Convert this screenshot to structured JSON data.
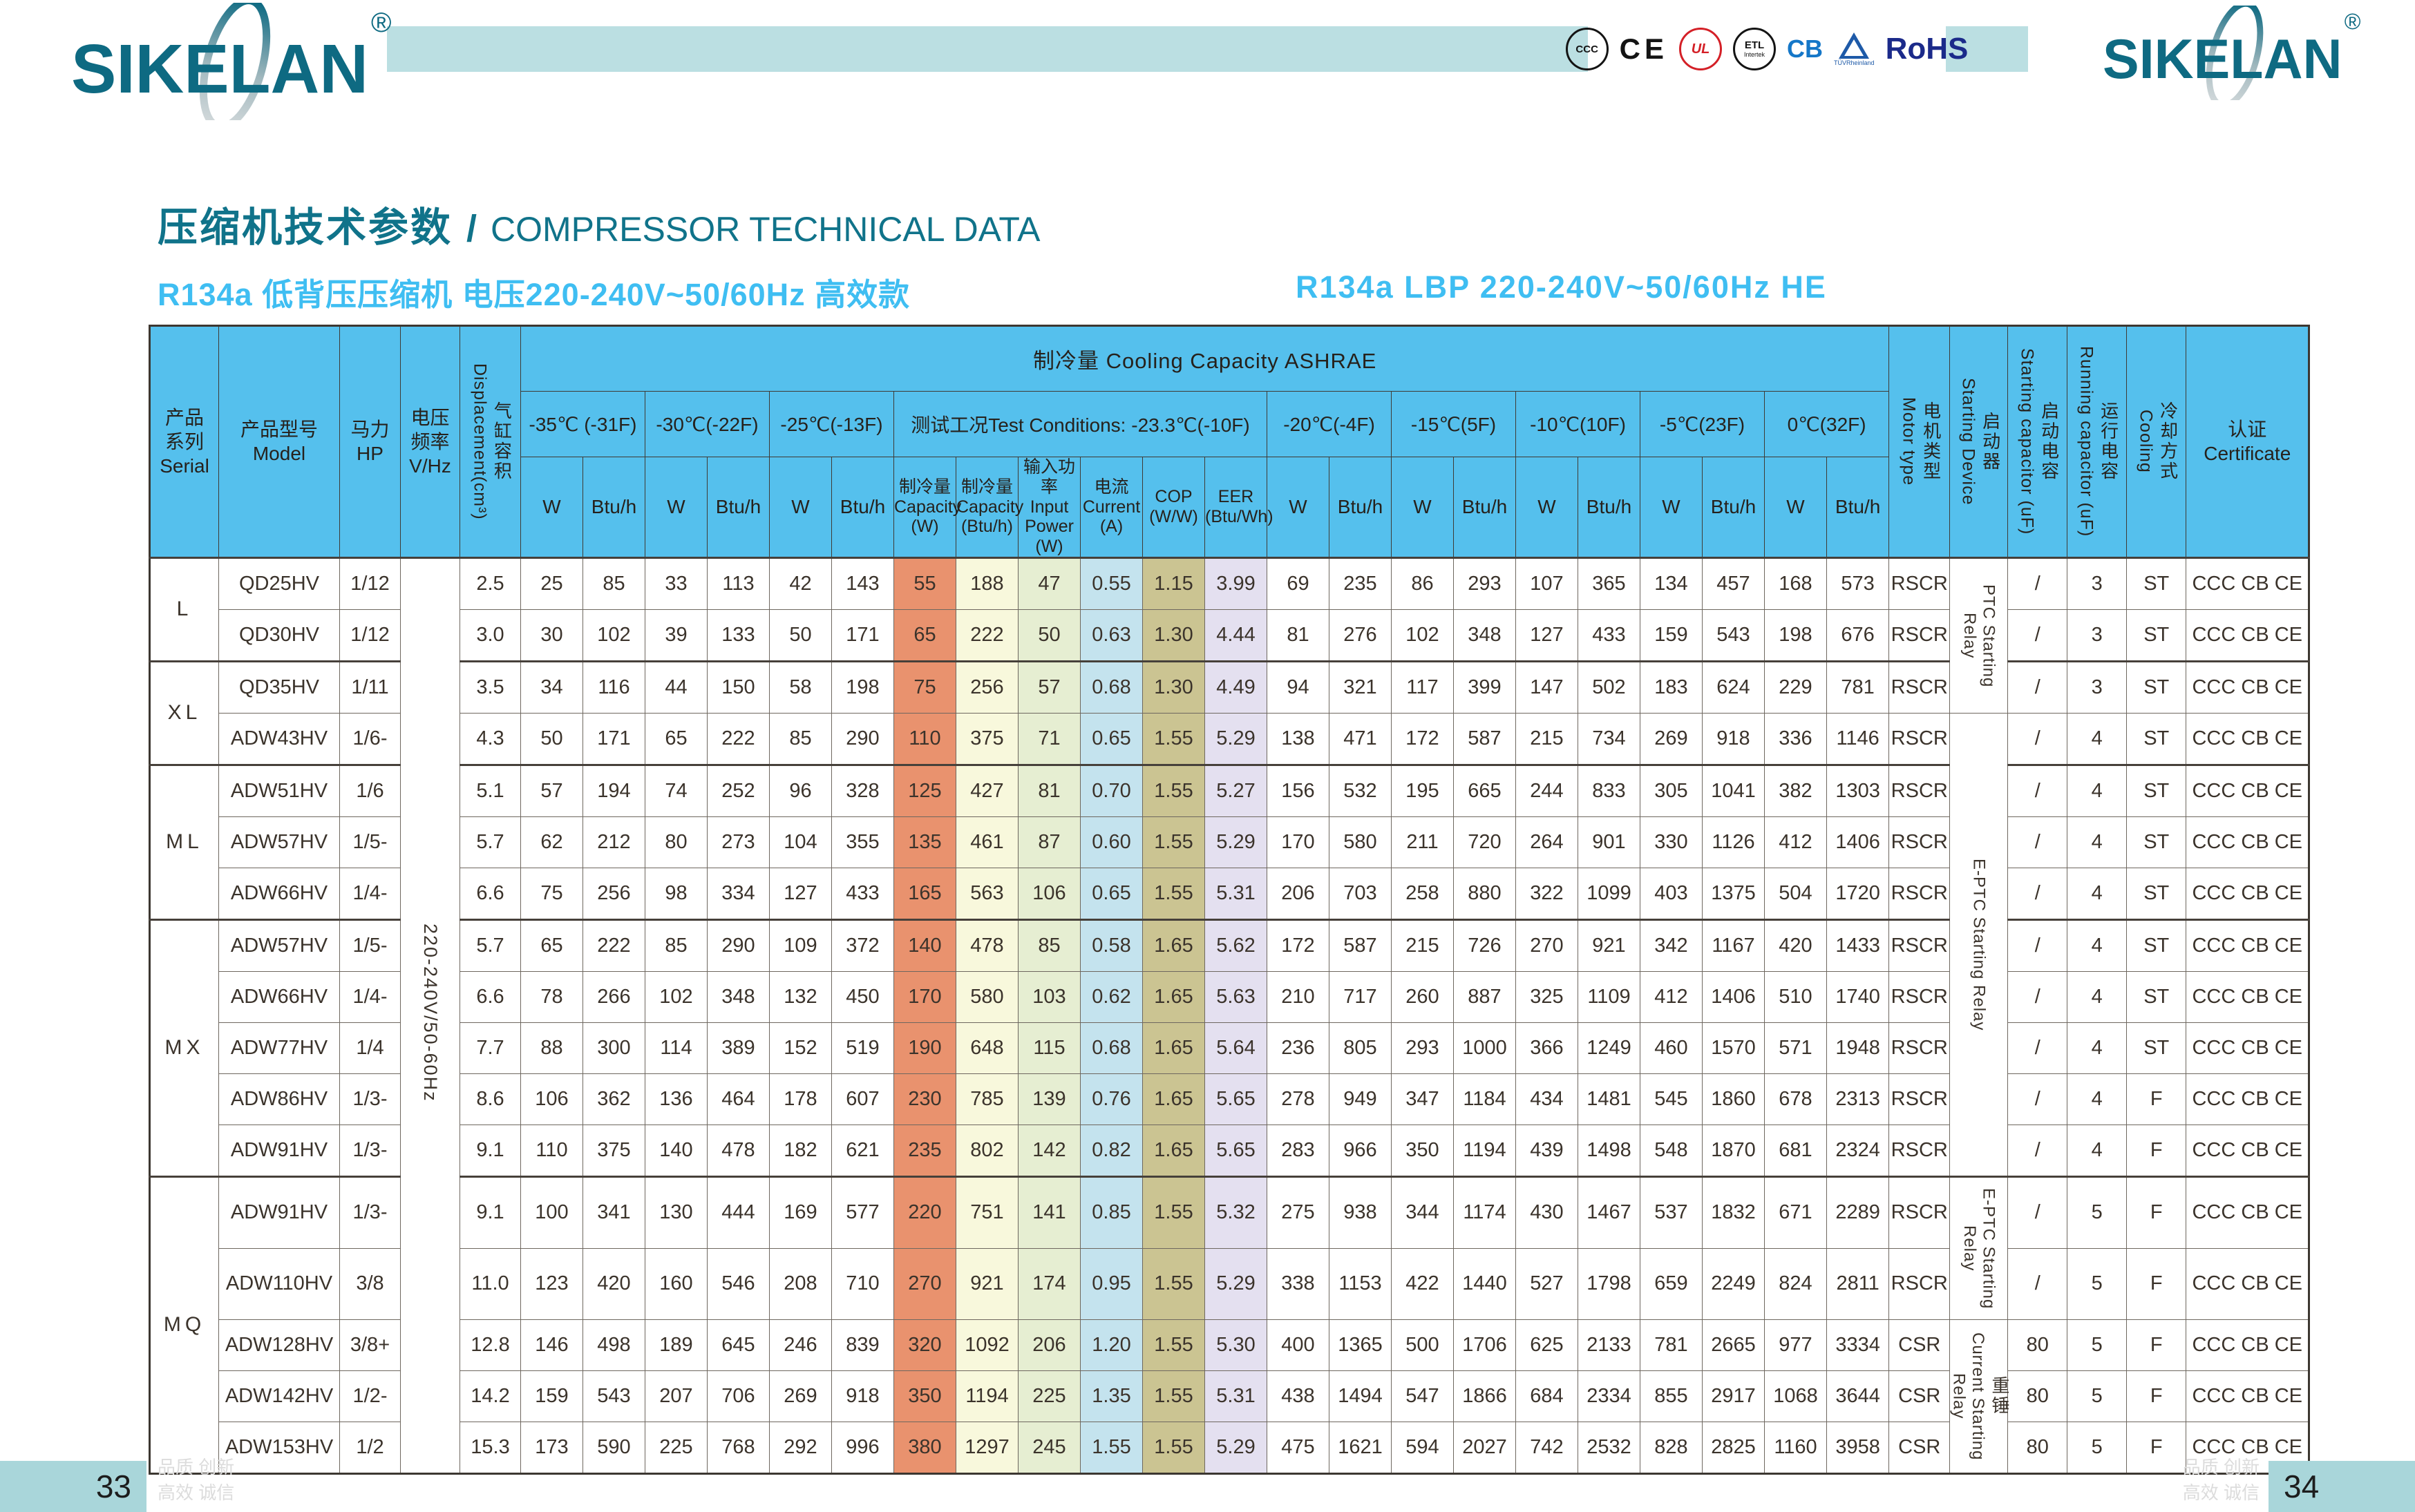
{
  "page": {
    "brand": "SIKELAN",
    "reg_mark": "®",
    "title_zh": "压缩机技术参数",
    "title_slash": "/",
    "title_en": "COMPRESSOR TECHNICAL DATA",
    "subtitle_left": "R134a   低背压压缩机   电压220-240V~50/60Hz   高效款",
    "subtitle_right": "R134a   LBP   220-240V~50/60Hz   HE",
    "footer": {
      "left_page": "33",
      "right_page": "34",
      "slogan_line1": "品质 创新",
      "slogan_line2": "高效 诚信"
    }
  },
  "colors": {
    "header_bg": "#55C0ED",
    "banner": "#BBDFE2",
    "page_block": "#A9D6DA",
    "brand_teal": "#0E6A82",
    "title_teal": "#10738A",
    "subtitle_blue": "#3FBEF2",
    "capacity_w_bg": "#E9926E",
    "capacity_btu_bg": "#F8F8DC",
    "input_power_bg": "#E6EED2",
    "current_bg": "#C4E3EE",
    "cop_bg": "#CBC492",
    "eer_bg": "#E4E0F0",
    "cb_blue": "#1577C8",
    "rohs_navy": "#1B2A8A",
    "ul_red": "#D42027",
    "tuv_blue": "#1E5AA8"
  },
  "certifications": [
    {
      "id": "ccc",
      "label": "CCC"
    },
    {
      "id": "ce",
      "label": "CE"
    },
    {
      "id": "ul",
      "label": "UL"
    },
    {
      "id": "etl",
      "label": "ETL",
      "sub": "Intertek"
    },
    {
      "id": "cb",
      "label": "CB"
    },
    {
      "id": "tuv",
      "label": "TÜVRheinland"
    },
    {
      "id": "rohs",
      "label": "RoHS"
    }
  ],
  "table": {
    "header": {
      "serial": [
        "产品",
        "系列",
        "Serial"
      ],
      "model": [
        "产品型号",
        "Model"
      ],
      "hp": "马力HP",
      "vhz": [
        "电压",
        "频率",
        "V/Hz"
      ],
      "disp": {
        "zh": "气缸容积",
        "en": "Displacement(cm³)"
      },
      "cooling_title": "制冷量    Cooling  Capacity  ASHRAE",
      "temps": [
        "-35℃ (-31F)",
        "-30℃(-22F)",
        "-25℃(-13F)",
        "测试工况Test Conditions: -23.3℃(-10F)",
        "-20℃(-4F)",
        "-15℃(5F)",
        "-10℃(10F)",
        "-5℃(23F)",
        "0℃(32F)"
      ],
      "unit_w": "W",
      "unit_btu": "Btu/h",
      "test_cols": [
        [
          "制冷量",
          "Capacity",
          "(W)"
        ],
        [
          "制冷量",
          "Capacity",
          "(Btu/h)"
        ],
        [
          "输入功率",
          "Input",
          "Power",
          "(W)"
        ],
        [
          "电流",
          "Current",
          "(A)"
        ],
        [
          "COP",
          "(W/W)"
        ],
        [
          "EER",
          "(Btu/Wh)"
        ]
      ],
      "motor": {
        "zh": "电机类型",
        "en": "Motor type"
      },
      "sdev": {
        "zh": "启动器",
        "en": "Starting Device"
      },
      "scap": {
        "zh": "启动电容",
        "en": "Starting capacitor (uF)"
      },
      "rcap": {
        "zh": "运行电容",
        "en": "Running capacitor (uF)"
      },
      "cool": {
        "zh": "冷却方式",
        "en": "Cooling"
      },
      "cert": [
        "认证",
        "Certificate"
      ]
    },
    "vhz": "220-240V/50-60Hz",
    "vhz_span": 17,
    "starting_devices": {
      "ptc": {
        "en": "PTC Starting Relay",
        "zh": "",
        "span": 3
      },
      "eptc": {
        "en": "E-PTC Starting Relay",
        "zh": "",
        "span": 9
      },
      "eptc2": {
        "en": "E-PTC Starting Relay",
        "zh": "",
        "span": 2
      },
      "csr": {
        "en": "Current Starting Relay",
        "zh": "重锤",
        "span": 3
      }
    },
    "rows": [
      {
        "serial": "L",
        "serial_span": 2,
        "model": "QD25HV",
        "hp": "1/12",
        "disp": "2.5",
        "c1": [
          "25",
          "85",
          "33",
          "113",
          "42",
          "143"
        ],
        "test": [
          "55",
          "188",
          "47",
          "0.55",
          "1.15",
          "3.99"
        ],
        "c2": [
          "69",
          "235",
          "86",
          "293",
          "107",
          "365",
          "134",
          "457",
          "168",
          "573"
        ],
        "motor": "RSCR",
        "sdev": "ptc",
        "scap": "/",
        "rcap": "3",
        "cool": "ST",
        "cert": "CCC CB CE"
      },
      {
        "model": "QD30HV",
        "hp": "1/12",
        "disp": "3.0",
        "c1": [
          "30",
          "102",
          "39",
          "133",
          "50",
          "171"
        ],
        "test": [
          "65",
          "222",
          "50",
          "0.63",
          "1.30",
          "4.44"
        ],
        "c2": [
          "81",
          "276",
          "102",
          "348",
          "127",
          "433",
          "159",
          "543",
          "198",
          "676"
        ],
        "motor": "RSCR",
        "scap": "/",
        "rcap": "3",
        "cool": "ST",
        "cert": "CCC CB CE"
      },
      {
        "serial": "XL",
        "serial_span": 2,
        "model": "QD35HV",
        "hp": "1/11",
        "disp": "3.5",
        "c1": [
          "34",
          "116",
          "44",
          "150",
          "58",
          "198"
        ],
        "test": [
          "75",
          "256",
          "57",
          "0.68",
          "1.30",
          "4.49"
        ],
        "c2": [
          "94",
          "321",
          "117",
          "399",
          "147",
          "502",
          "183",
          "624",
          "229",
          "781"
        ],
        "motor": "RSCR",
        "scap": "/",
        "rcap": "3",
        "cool": "ST",
        "cert": "CCC CB CE"
      },
      {
        "model": "ADW43HV",
        "hp": "1/6-",
        "disp": "4.3",
        "c1": [
          "50",
          "171",
          "65",
          "222",
          "85",
          "290"
        ],
        "test": [
          "110",
          "375",
          "71",
          "0.65",
          "1.55",
          "5.29"
        ],
        "c2": [
          "138",
          "471",
          "172",
          "587",
          "215",
          "734",
          "269",
          "918",
          "336",
          "1146"
        ],
        "motor": "RSCR",
        "sdev": "eptc",
        "scap": "/",
        "rcap": "4",
        "cool": "ST",
        "cert": "CCC CB CE"
      },
      {
        "serial": "ML",
        "serial_span": 3,
        "model": "ADW51HV",
        "hp": "1/6",
        "disp": "5.1",
        "c1": [
          "57",
          "194",
          "74",
          "252",
          "96",
          "328"
        ],
        "test": [
          "125",
          "427",
          "81",
          "0.70",
          "1.55",
          "5.27"
        ],
        "c2": [
          "156",
          "532",
          "195",
          "665",
          "244",
          "833",
          "305",
          "1041",
          "382",
          "1303"
        ],
        "motor": "RSCR",
        "scap": "/",
        "rcap": "4",
        "cool": "ST",
        "cert": "CCC CB CE"
      },
      {
        "model": "ADW57HV",
        "hp": "1/5-",
        "disp": "5.7",
        "c1": [
          "62",
          "212",
          "80",
          "273",
          "104",
          "355"
        ],
        "test": [
          "135",
          "461",
          "87",
          "0.60",
          "1.55",
          "5.29"
        ],
        "c2": [
          "170",
          "580",
          "211",
          "720",
          "264",
          "901",
          "330",
          "1126",
          "412",
          "1406"
        ],
        "motor": "RSCR",
        "scap": "/",
        "rcap": "4",
        "cool": "ST",
        "cert": "CCC CB CE"
      },
      {
        "model": "ADW66HV",
        "hp": "1/4-",
        "disp": "6.6",
        "c1": [
          "75",
          "256",
          "98",
          "334",
          "127",
          "433"
        ],
        "test": [
          "165",
          "563",
          "106",
          "0.65",
          "1.55",
          "5.31"
        ],
        "c2": [
          "206",
          "703",
          "258",
          "880",
          "322",
          "1099",
          "403",
          "1375",
          "504",
          "1720"
        ],
        "motor": "RSCR",
        "scap": "/",
        "rcap": "4",
        "cool": "ST",
        "cert": "CCC CB CE"
      },
      {
        "serial": "MX",
        "serial_span": 5,
        "model": "ADW57HV",
        "hp": "1/5-",
        "disp": "5.7",
        "c1": [
          "65",
          "222",
          "85",
          "290",
          "109",
          "372"
        ],
        "test": [
          "140",
          "478",
          "85",
          "0.58",
          "1.65",
          "5.62"
        ],
        "c2": [
          "172",
          "587",
          "215",
          "726",
          "270",
          "921",
          "342",
          "1167",
          "420",
          "1433"
        ],
        "motor": "RSCR",
        "scap": "/",
        "rcap": "4",
        "cool": "ST",
        "cert": "CCC CB CE"
      },
      {
        "model": "ADW66HV",
        "hp": "1/4-",
        "disp": "6.6",
        "c1": [
          "78",
          "266",
          "102",
          "348",
          "132",
          "450"
        ],
        "test": [
          "170",
          "580",
          "103",
          "0.62",
          "1.65",
          "5.63"
        ],
        "c2": [
          "210",
          "717",
          "260",
          "887",
          "325",
          "1109",
          "412",
          "1406",
          "510",
          "1740"
        ],
        "motor": "RSCR",
        "scap": "/",
        "rcap": "4",
        "cool": "ST",
        "cert": "CCC CB CE"
      },
      {
        "model": "ADW77HV",
        "hp": "1/4",
        "disp": "7.7",
        "c1": [
          "88",
          "300",
          "114",
          "389",
          "152",
          "519"
        ],
        "test": [
          "190",
          "648",
          "115",
          "0.68",
          "1.65",
          "5.64"
        ],
        "c2": [
          "236",
          "805",
          "293",
          "1000",
          "366",
          "1249",
          "460",
          "1570",
          "571",
          "1948"
        ],
        "motor": "RSCR",
        "scap": "/",
        "rcap": "4",
        "cool": "ST",
        "cert": "CCC CB CE"
      },
      {
        "model": "ADW86HV",
        "hp": "1/3-",
        "disp": "8.6",
        "c1": [
          "106",
          "362",
          "136",
          "464",
          "178",
          "607"
        ],
        "test": [
          "230",
          "785",
          "139",
          "0.76",
          "1.65",
          "5.65"
        ],
        "c2": [
          "278",
          "949",
          "347",
          "1184",
          "434",
          "1481",
          "545",
          "1860",
          "678",
          "2313"
        ],
        "motor": "RSCR",
        "scap": "/",
        "rcap": "4",
        "cool": "F",
        "cert": "CCC CB CE"
      },
      {
        "model": "ADW91HV",
        "hp": "1/3-",
        "disp": "9.1",
        "c1": [
          "110",
          "375",
          "140",
          "478",
          "182",
          "621"
        ],
        "test": [
          "235",
          "802",
          "142",
          "0.82",
          "1.65",
          "5.65"
        ],
        "c2": [
          "283",
          "966",
          "350",
          "1194",
          "439",
          "1498",
          "548",
          "1870",
          "681",
          "2324"
        ],
        "motor": "RSCR",
        "scap": "/",
        "rcap": "4",
        "cool": "F",
        "cert": "CCC CB CE"
      },
      {
        "serial": "MQ",
        "serial_span": 5,
        "model": "ADW91HV",
        "hp": "1/3-",
        "disp": "9.1",
        "c1": [
          "100",
          "341",
          "130",
          "444",
          "169",
          "577"
        ],
        "test": [
          "220",
          "751",
          "141",
          "0.85",
          "1.55",
          "5.32"
        ],
        "c2": [
          "275",
          "938",
          "344",
          "1174",
          "430",
          "1467",
          "537",
          "1832",
          "671",
          "2289"
        ],
        "motor": "RSCR",
        "sdev": "eptc2",
        "scap": "/",
        "rcap": "5",
        "cool": "F",
        "cert": "CCC CB CE"
      },
      {
        "model": "ADW110HV",
        "hp": "3/8",
        "disp": "11.0",
        "c1": [
          "123",
          "420",
          "160",
          "546",
          "208",
          "710"
        ],
        "test": [
          "270",
          "921",
          "174",
          "0.95",
          "1.55",
          "5.29"
        ],
        "c2": [
          "338",
          "1153",
          "422",
          "1440",
          "527",
          "1798",
          "659",
          "2249",
          "824",
          "2811"
        ],
        "motor": "RSCR",
        "scap": "/",
        "rcap": "5",
        "cool": "F",
        "cert": "CCC CB CE"
      },
      {
        "model": "ADW128HV",
        "hp": "3/8+",
        "disp": "12.8",
        "c1": [
          "146",
          "498",
          "189",
          "645",
          "246",
          "839"
        ],
        "test": [
          "320",
          "1092",
          "206",
          "1.20",
          "1.55",
          "5.30"
        ],
        "c2": [
          "400",
          "1365",
          "500",
          "1706",
          "625",
          "2133",
          "781",
          "2665",
          "977",
          "3334"
        ],
        "motor": "CSR",
        "sdev": "csr",
        "scap": "80",
        "rcap": "5",
        "cool": "F",
        "cert": "CCC CB CE"
      },
      {
        "model": "ADW142HV",
        "hp": "1/2-",
        "disp": "14.2",
        "c1": [
          "159",
          "543",
          "207",
          "706",
          "269",
          "918"
        ],
        "test": [
          "350",
          "1194",
          "225",
          "1.35",
          "1.55",
          "5.31"
        ],
        "c2": [
          "438",
          "1494",
          "547",
          "1866",
          "684",
          "2334",
          "855",
          "2917",
          "1068",
          "3644"
        ],
        "motor": "CSR",
        "scap": "80",
        "rcap": "5",
        "cool": "F",
        "cert": "CCC CB CE"
      },
      {
        "model": "ADW153HV",
        "hp": "1/2",
        "disp": "15.3",
        "c1": [
          "173",
          "590",
          "225",
          "768",
          "292",
          "996"
        ],
        "test": [
          "380",
          "1297",
          "245",
          "1.55",
          "1.55",
          "5.29"
        ],
        "c2": [
          "475",
          "1621",
          "594",
          "2027",
          "742",
          "2532",
          "828",
          "2825",
          "1160",
          "3958"
        ],
        "motor": "CSR",
        "scap": "80",
        "rcap": "5",
        "cool": "F",
        "cert": "CCC CB CE"
      }
    ]
  }
}
